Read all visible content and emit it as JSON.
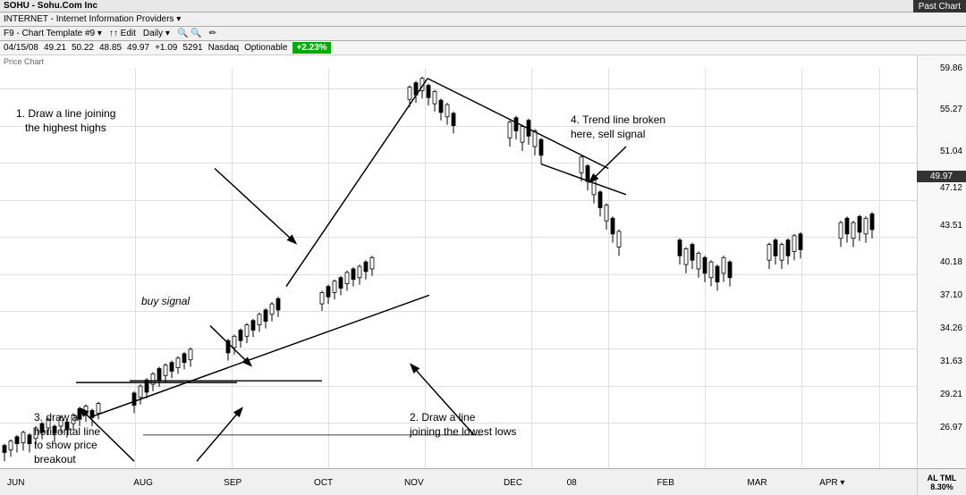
{
  "topbar": {
    "ticker": "SOHU - Sohu.Com Inc",
    "sector": "INTERNET - Internet Information Providers ▾",
    "past_chart": "Past Chart"
  },
  "toolbar": {
    "template": "F9 - Chart Template #9 ▾",
    "edit": "↑↑ Edit",
    "timeframe": "Daily ▾",
    "zoom_icons": "🔍 🔍",
    "draw_icon": "✏"
  },
  "infobar": {
    "date": "04/15/08",
    "o": "49.21",
    "h": "50.22",
    "l": "48.85",
    "c": "49.97",
    "change": "+1.09",
    "volume": "5291",
    "exchange": "Nasdaq",
    "optionable": "Optionable",
    "pct_change": "+2.23%"
  },
  "chart_label": "Price Chart",
  "price_levels": [
    {
      "price": "59.86",
      "top_pct": 2
    },
    {
      "price": "55.27",
      "top_pct": 12
    },
    {
      "price": "51.04",
      "top_pct": 22
    },
    {
      "price": "47.12",
      "top_pct": 31
    },
    {
      "price": "43.51",
      "top_pct": 40
    },
    {
      "price": "40.18",
      "top_pct": 49
    },
    {
      "price": "37.10",
      "top_pct": 57
    },
    {
      "price": "34.26",
      "top_pct": 65
    },
    {
      "price": "31.63",
      "top_pct": 73
    },
    {
      "price": "29.21",
      "top_pct": 81
    },
    {
      "price": "26.97",
      "top_pct": 89
    }
  ],
  "current_price": "49.97",
  "annotations": {
    "ann1": {
      "text": "1. Draw a line joining\n   the highest highs",
      "style": "top:60px; left:20px;"
    },
    "ann2": {
      "text": "buy signal",
      "style": "top:270px; left:160px;"
    },
    "ann3": {
      "text": "3. draw a\nhorizontal line\nto show price\nbreakout",
      "style": "top:400px; left:40px;"
    },
    "ann4": {
      "text": "2. Draw a line\njoining the lowest lows",
      "style": "top:400px; left:460px;"
    },
    "ann5": {
      "text": "4. Trend line broken\nhere, sell signal",
      "style": "top:68px; left:640px;"
    }
  },
  "months": [
    {
      "label": "JUN",
      "left_pct": 0
    },
    {
      "label": "AUG",
      "left_pct": 14
    },
    {
      "label": "SEP",
      "left_pct": 24
    },
    {
      "label": "OCT",
      "left_pct": 34
    },
    {
      "label": "NOV",
      "left_pct": 44
    },
    {
      "label": "DEC",
      "left_pct": 55
    },
    {
      "label": "08",
      "left_pct": 63
    },
    {
      "label": "FEB",
      "left_pct": 73
    },
    {
      "label": "MAR",
      "left_pct": 83
    },
    {
      "label": "APR",
      "left_pct": 91
    }
  ],
  "bottom_right": {
    "al": "AL",
    "tml": "TML",
    "pct": "8.30%"
  }
}
